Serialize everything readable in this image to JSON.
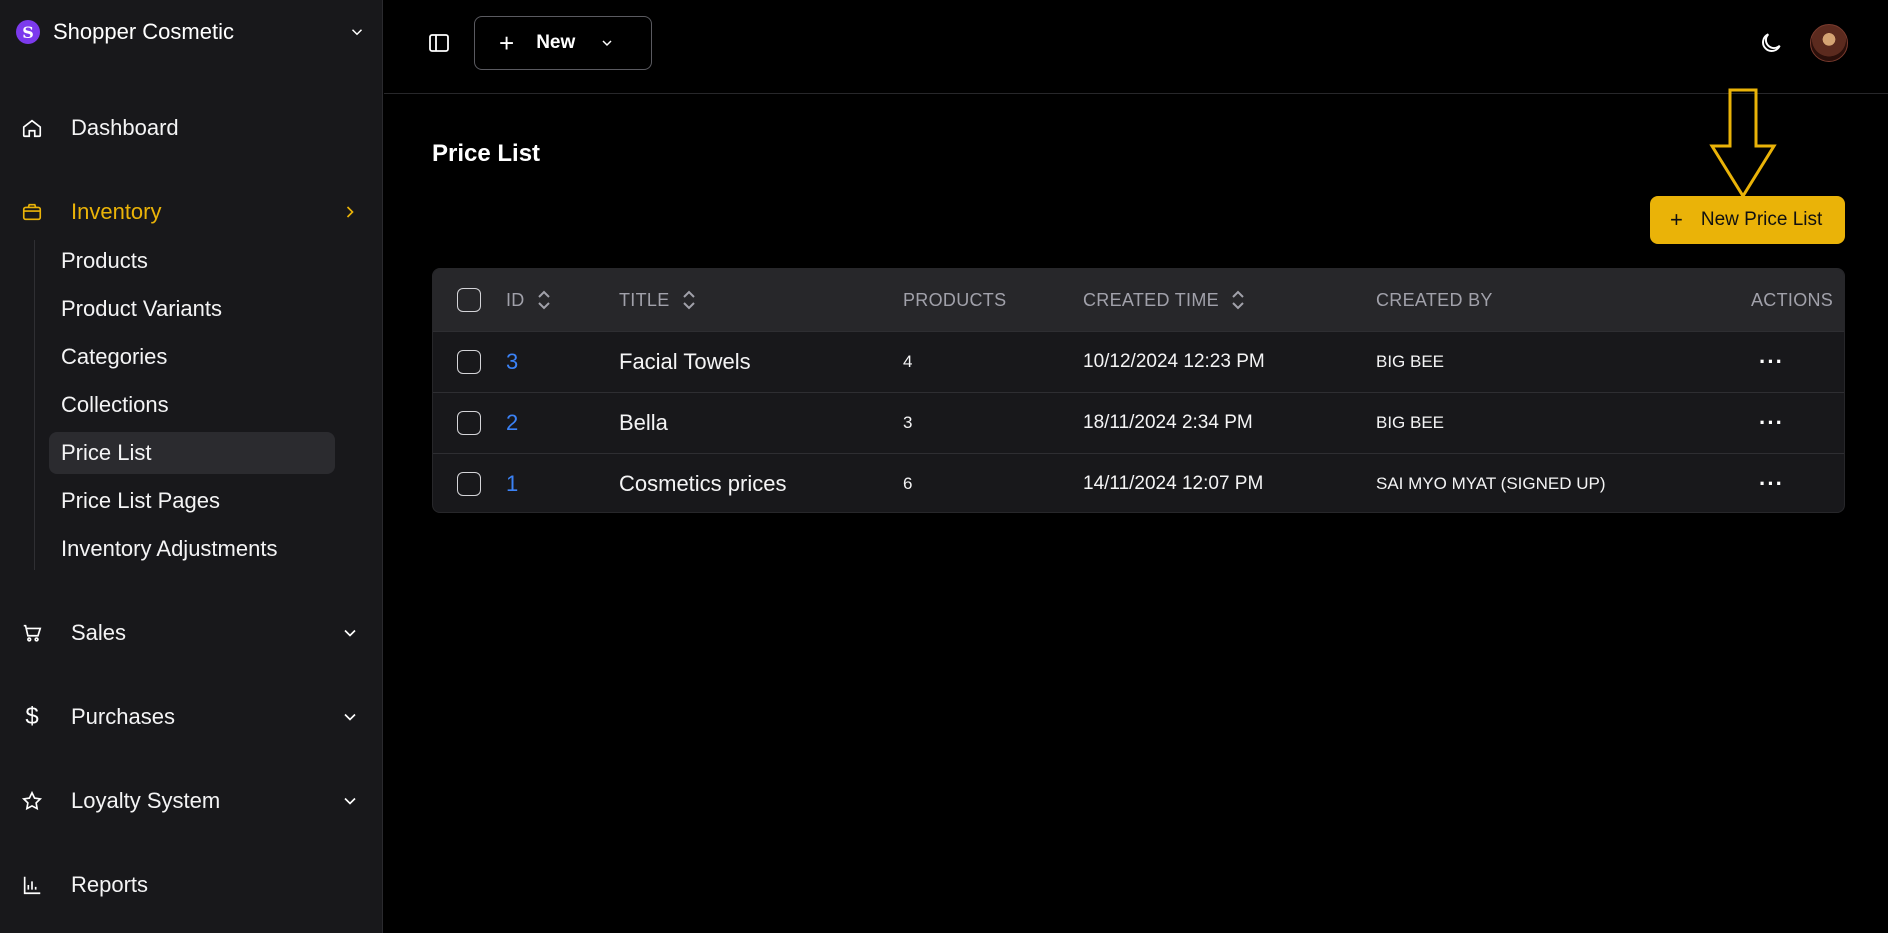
{
  "sidebar": {
    "brand_initial": "S",
    "brand_name": "Shopper Cosmetic",
    "items": {
      "dashboard": "Dashboard",
      "inventory": "Inventory",
      "sales": "Sales",
      "purchases": "Purchases",
      "loyalty": "Loyalty System",
      "reports": "Reports"
    },
    "inventory_sub": [
      "Products",
      "Product Variants",
      "Categories",
      "Collections",
      "Price List",
      "Price List Pages",
      "Inventory Adjustments"
    ],
    "active_item": "Inventory",
    "active_sub": "Price List"
  },
  "topbar": {
    "new_label": "New"
  },
  "main": {
    "title": "Price List",
    "new_button_label": "New Price List",
    "table": {
      "headers": {
        "id": "ID",
        "title": "TITLE",
        "products": "PRODUCTS",
        "created_time": "CREATED TIME",
        "created_by": "CREATED BY",
        "actions": "ACTIONS"
      },
      "rows": [
        {
          "id": "3",
          "title": "Facial Towels",
          "products": "4",
          "created_time": "10/12/2024 12:23 PM",
          "created_by": "BIG BEE",
          "actions": "···"
        },
        {
          "id": "2",
          "title": "Bella",
          "products": "3",
          "created_time": "18/11/2024 2:34 PM",
          "created_by": "BIG BEE",
          "actions": "···"
        },
        {
          "id": "1",
          "title": "Cosmetics prices",
          "products": "6",
          "created_time": "14/11/2024 12:07 PM",
          "created_by": "SAI MYO MYAT (SIGNED UP)",
          "actions": "···"
        }
      ]
    }
  },
  "colors": {
    "accent": "#eab308",
    "link": "#3b82f6",
    "background": "#000000",
    "sidebar": "#18181b"
  }
}
